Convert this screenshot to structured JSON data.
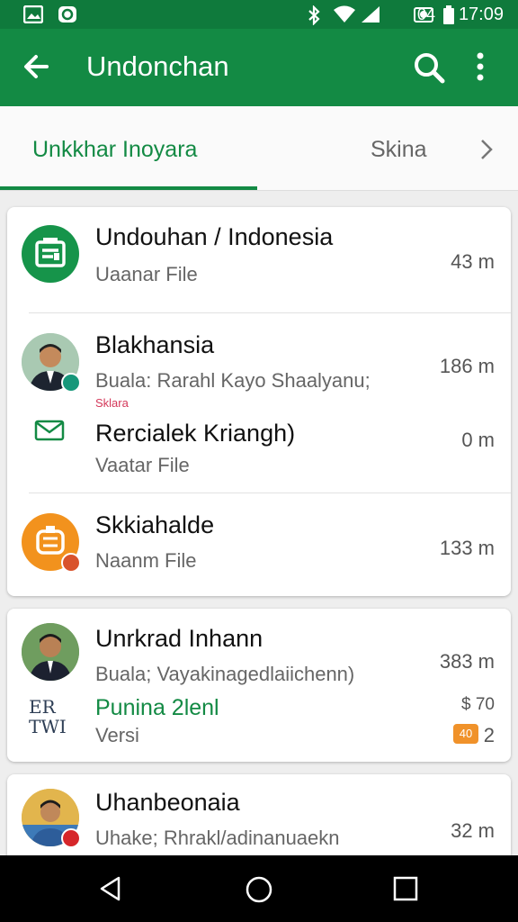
{
  "status_bar": {
    "percent": "04",
    "time": "17:09"
  },
  "app_bar": {
    "title": "Undonchan"
  },
  "tabs": [
    {
      "label": "Unkkhar Inoyara"
    },
    {
      "label": "Skina"
    }
  ],
  "card1": {
    "items": [
      {
        "title": "Undouhan / Indonesia",
        "subtitle": "Uaanar File",
        "meta": "43 m"
      },
      {
        "title": "Blakhansia",
        "subtitle": "Buala: Rarahl Kayo Shaalyanu;",
        "tag": "Sklara",
        "meta": "186 m"
      },
      {
        "title": "Rercialek Kriangh)",
        "subtitle": "Vaatar File",
        "meta": "0 m"
      },
      {
        "title": "Skkiahalde",
        "subtitle": "Naanm File",
        "meta": "133 m"
      }
    ]
  },
  "card2": {
    "items": [
      {
        "title": "Unrkrad Inhann",
        "subtitle": "Buala; Vayakinagedlaiichenn)",
        "meta": "383 m"
      },
      {
        "title": "Punina 2lenl",
        "subtitle": "Versi",
        "meta": "$ 70",
        "badge": "40",
        "count": "2",
        "logo_lines": [
          "ER",
          "TWI"
        ]
      }
    ]
  },
  "card3": {
    "items": [
      {
        "title": "Uhanbeonaia",
        "subtitle": "Uhake; Rhrakl/adinanuaekn",
        "meta": "32 m"
      }
    ]
  },
  "colors": {
    "primary": "#138a44",
    "accent_orange": "#f0922a",
    "status_green": "#0f7a3c"
  }
}
